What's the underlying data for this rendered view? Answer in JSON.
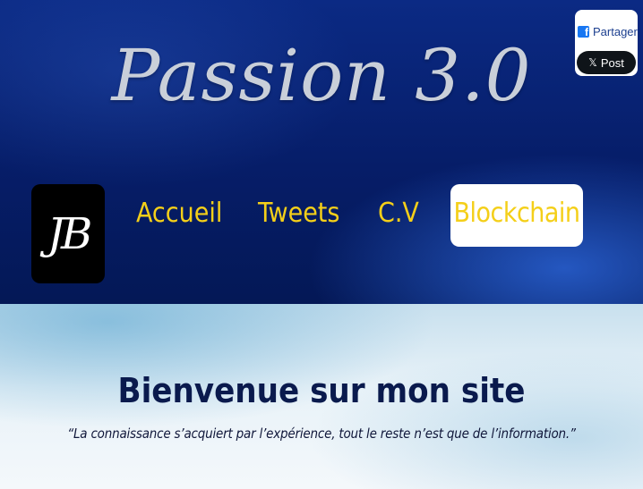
{
  "header": {
    "title": "Passion 3.0"
  },
  "share": {
    "facebook_label": "Partager",
    "facebook_icon": "facebook-icon",
    "x_label": "Post",
    "x_icon": "x-icon"
  },
  "logo": {
    "text": "JB"
  },
  "nav": {
    "items": [
      {
        "label": "Accueil"
      },
      {
        "label": "Tweets"
      },
      {
        "label": "C.V"
      },
      {
        "label": "Blockchain",
        "active": true
      }
    ]
  },
  "main": {
    "heading": "Bienvenue sur mon site",
    "quote": "“La connaissance s’acquiert par l’expérience, tout le reste n’est que de l’information.”"
  },
  "colors": {
    "header_bg": "#061d68",
    "nav_text": "#f4cf19",
    "active_bg": "#ffffff",
    "heading": "#0a1a4d"
  }
}
